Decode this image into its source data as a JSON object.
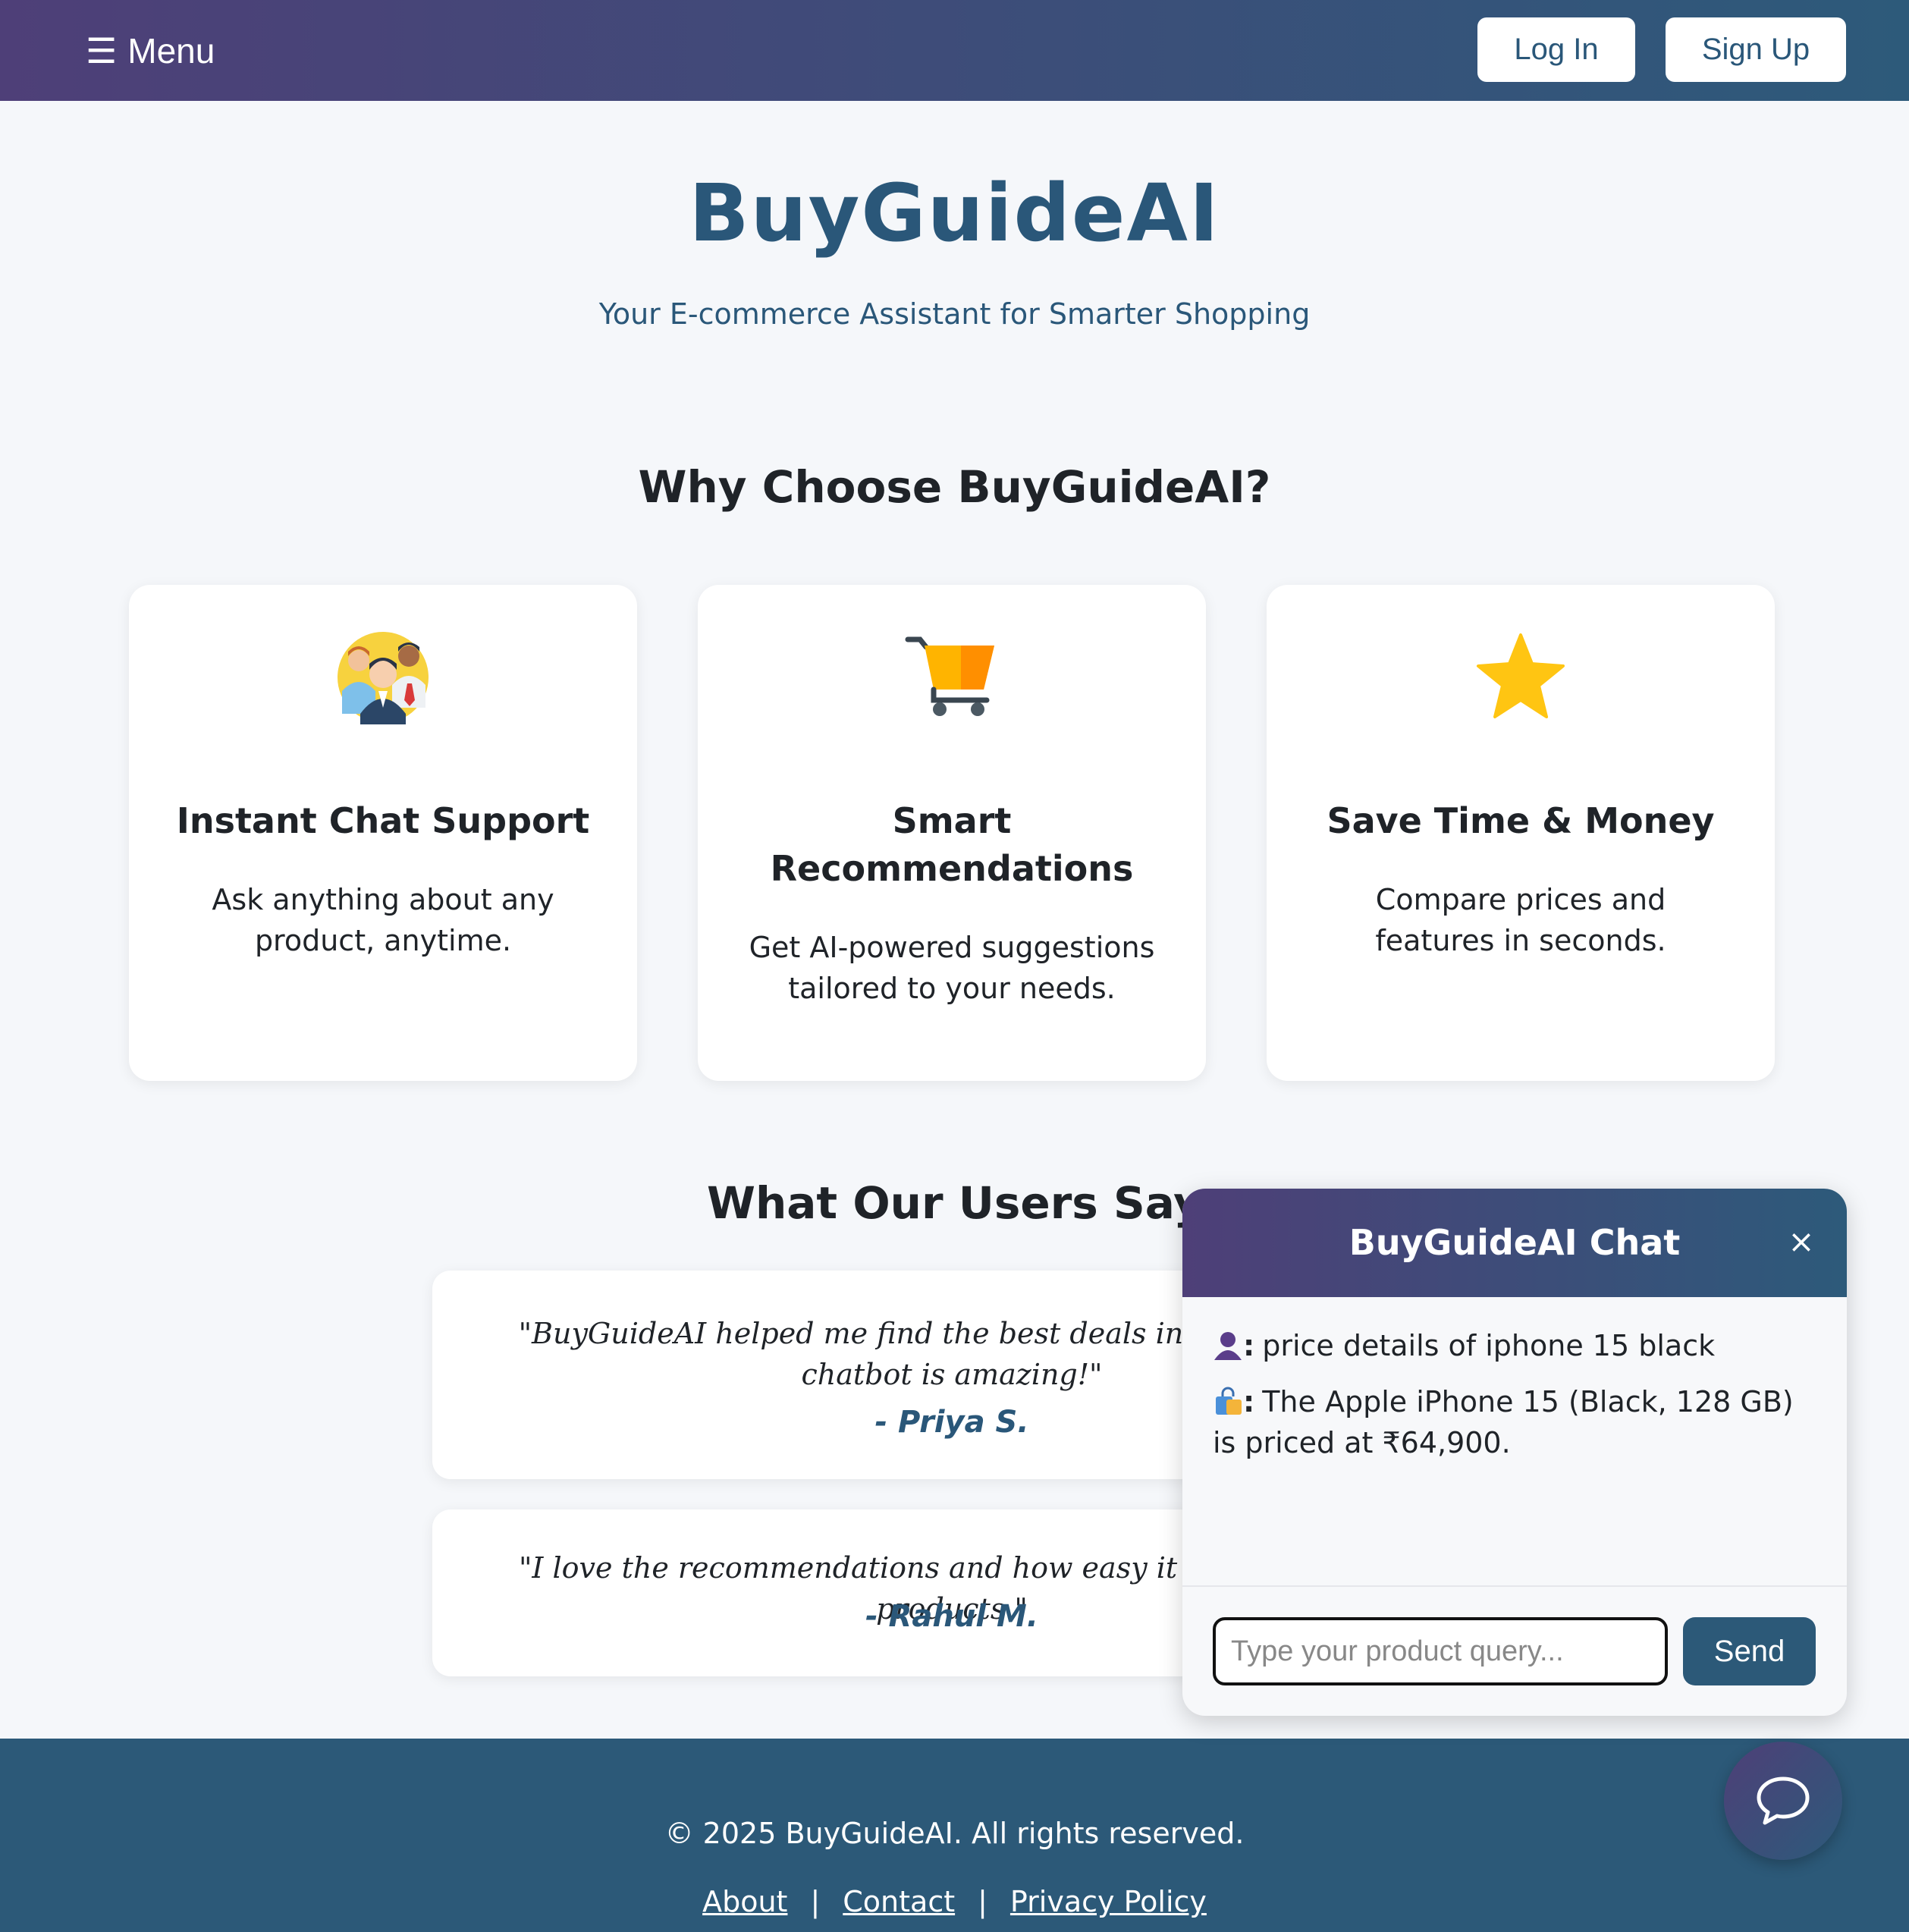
{
  "nav": {
    "menu_icon": "☰",
    "menu_label": "Menu",
    "login_label": "Log In",
    "signup_label": "Sign Up"
  },
  "hero": {
    "title": "BuyGuideAI",
    "subtitle": "Your E-commerce Assistant for Smarter Shopping"
  },
  "why": {
    "heading": "Why Choose BuyGuideAI?",
    "features": [
      {
        "icon": "people-icon",
        "title": "Instant Chat Support",
        "description": "Ask anything about any product, anytime."
      },
      {
        "icon": "shopping-cart-icon",
        "title": "Smart Recommendations",
        "description": "Get AI-powered suggestions tailored to your needs."
      },
      {
        "icon": "star-icon",
        "title": "Save Time & Money",
        "description": "Compare prices and features in seconds."
      }
    ]
  },
  "testimonials": {
    "heading": "What Our Users Say",
    "items": [
      {
        "quote": "\"BuyGuideAI helped me find the best deals in seconds! The chatbot is amazing!\"",
        "author": "- Priya S."
      },
      {
        "quote": "\"I love the recommendations and how easy it is to compare products.\"",
        "author": "- Rahul M."
      }
    ]
  },
  "footer": {
    "copyright": "© 2025 BuyGuideAI. All rights reserved.",
    "links": [
      "About",
      "Contact",
      "Privacy Policy"
    ],
    "separator": "|"
  },
  "chat": {
    "title": "BuyGuideAI Chat",
    "close_symbol": "×",
    "messages": [
      {
        "sender": "user",
        "icon": "user-silhouette-icon",
        "text": "price details of iphone 15 black"
      },
      {
        "sender": "bot",
        "icon": "shopping-bag-icon",
        "text": "The Apple iPhone 15 (Black, 128 GB) is priced at ₹64,900."
      }
    ],
    "colon": ":",
    "input_placeholder": "Type your product query...",
    "input_value": "",
    "send_label": "Send"
  },
  "colors": {
    "brand_gradient_start": "#4e3f78",
    "brand_gradient_end": "#2d5a7a",
    "brand_text": "#2a5779",
    "footer_bg": "#2c5978",
    "page_bg": "#f5f7fa"
  }
}
